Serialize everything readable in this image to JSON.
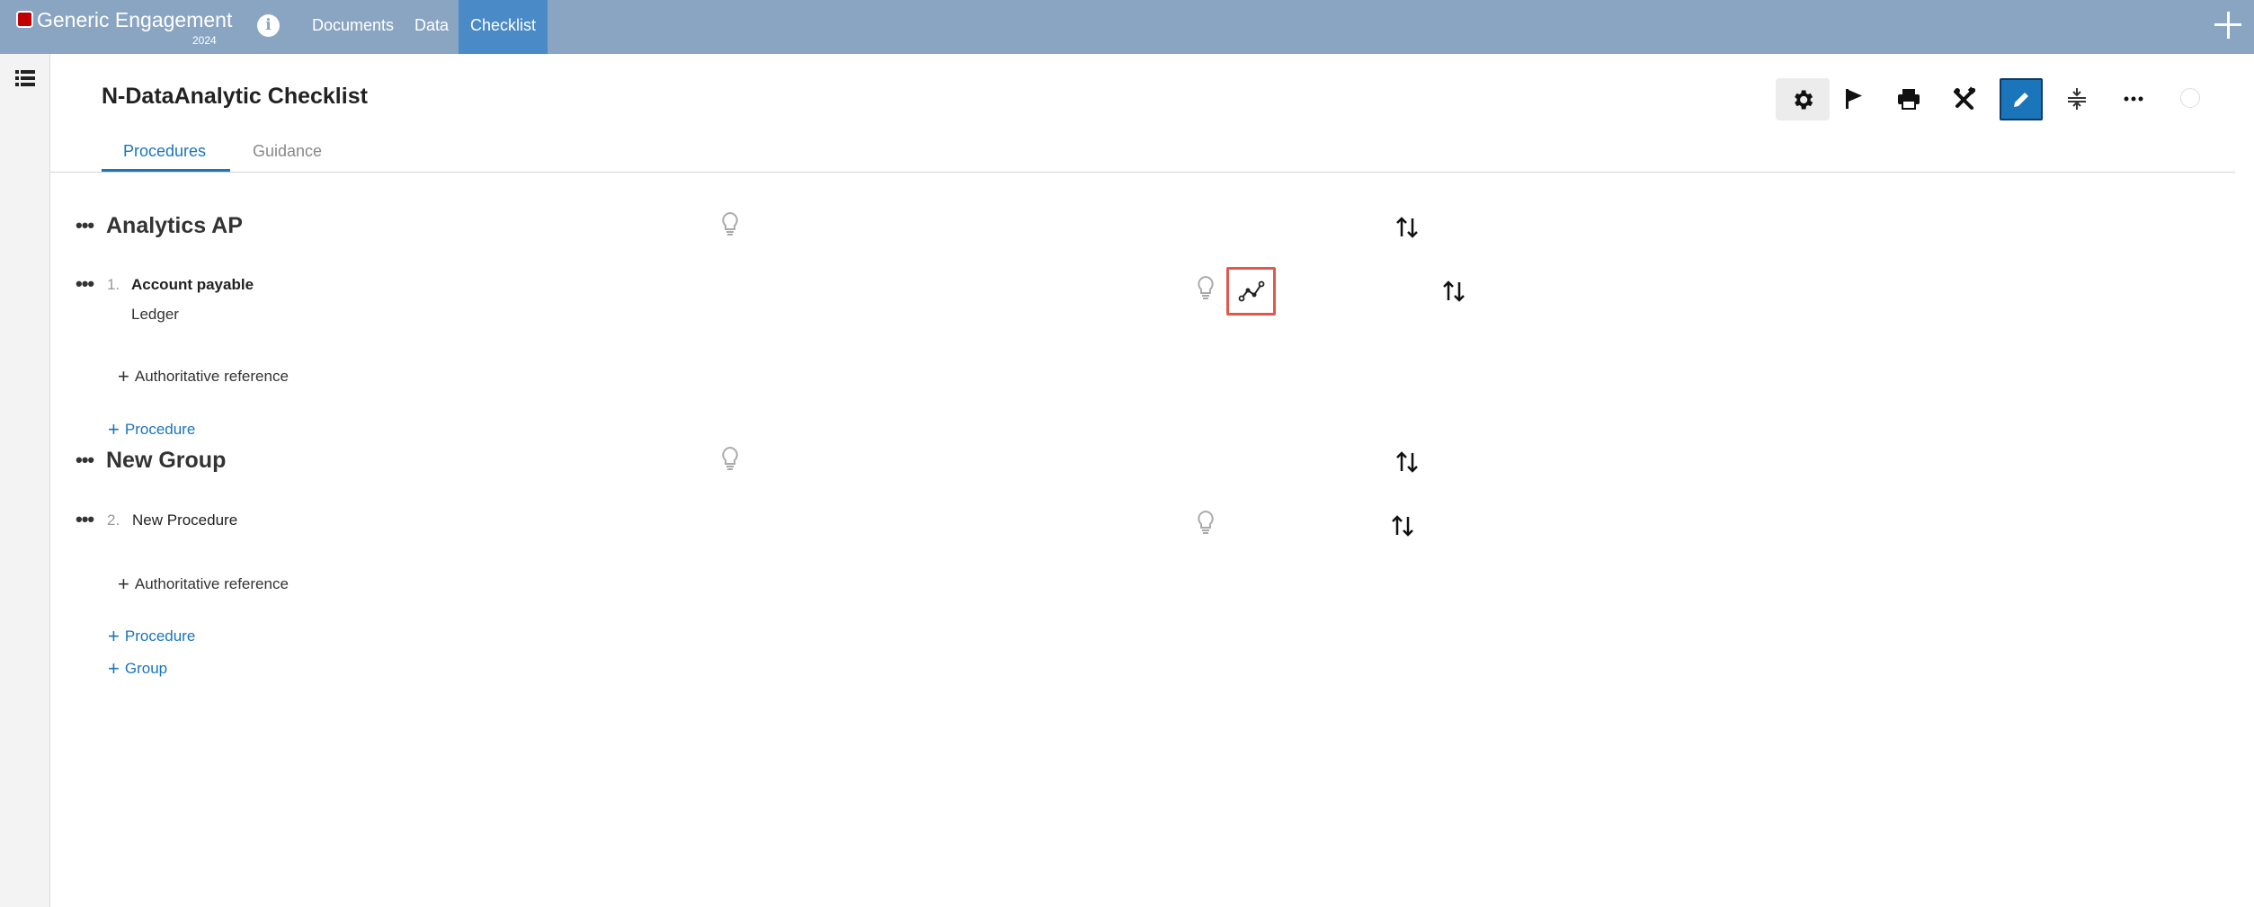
{
  "topbar": {
    "app_title": "Generic Engagement",
    "app_year": "2024",
    "nav": [
      "Documents",
      "Data",
      "Checklist"
    ],
    "active_nav": "Checklist",
    "bar_color": "#8aa5c2",
    "active_color": "#4a8bc7"
  },
  "header": {
    "title": "N-DataAnalytic Checklist",
    "tabs": [
      "Procedures",
      "Guidance"
    ],
    "active_tab": "Procedures",
    "toolbar_icons": [
      "gear-icon",
      "flag-icon",
      "print-icon",
      "tools-icon",
      "pencil-icon",
      "collapse-icon",
      "more-icon",
      "status-circle-icon"
    ]
  },
  "checklist": {
    "groups": [
      {
        "title": "Analytics AP",
        "procedures": [
          {
            "number": "1.",
            "title": "Account payable",
            "subtitle": "Ledger",
            "add_reference_label": "Authoritative reference"
          }
        ],
        "add_procedure_label": "Procedure"
      },
      {
        "title": "New Group",
        "procedures": [
          {
            "number": "2.",
            "title": "New Procedure",
            "add_reference_label": "Authoritative reference"
          }
        ],
        "add_procedure_label": "Procedure"
      }
    ],
    "add_group_label": "Group",
    "highlight_color": "#e2574c",
    "accent_color": "#1a75bb"
  }
}
